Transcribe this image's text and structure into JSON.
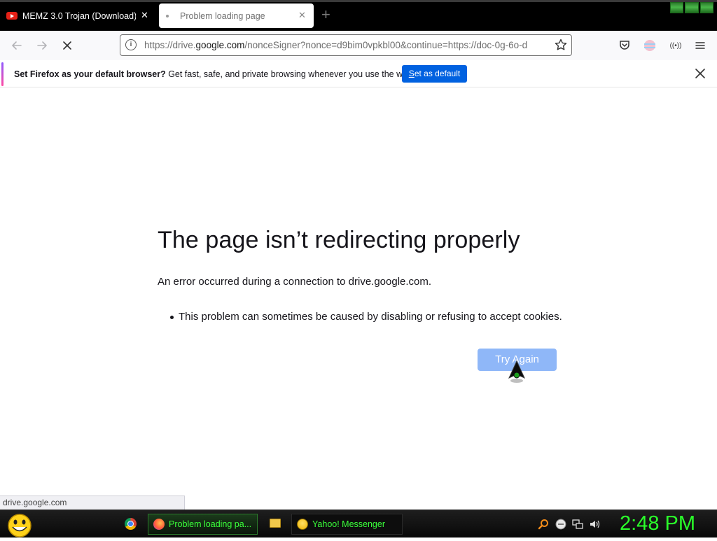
{
  "tabs": [
    {
      "title": "MEMZ 3.0 Trojan (Download) -",
      "close": "✕"
    },
    {
      "title": "Problem loading page",
      "close": "✕"
    }
  ],
  "new_tab": "+",
  "address_bar": {
    "url_prefix": "https://drive.",
    "url_domain": "google.com",
    "url_suffix": "/nonceSigner?nonce=d9bim0vpkbl00&continue=https://doc-0g-6o-d"
  },
  "notification": {
    "message_bold": "Set Firefox as your default browser?",
    "message": " Get fast, safe, and private browsing whenever you use the web.",
    "button": "Set as default"
  },
  "error_page": {
    "title": "The page isn’t redirecting properly",
    "description": "An error occurred during a connection to drive.google.com.",
    "bullets": [
      "This problem can sometimes be caused by disabling or refusing to accept cookies."
    ],
    "try_again": "Try Again"
  },
  "status_link": "drive.google.com",
  "taskbar": {
    "firefox_label": "Problem loading pa...",
    "yahoo_label": "Yahoo! Messenger",
    "clock": "2:48 PM"
  },
  "colors": {
    "accent_blue": "#0061e0",
    "try_again_bg": "#8ab4f8",
    "taskbar_text": "#3aff3a",
    "clock": "#2aff2a"
  }
}
